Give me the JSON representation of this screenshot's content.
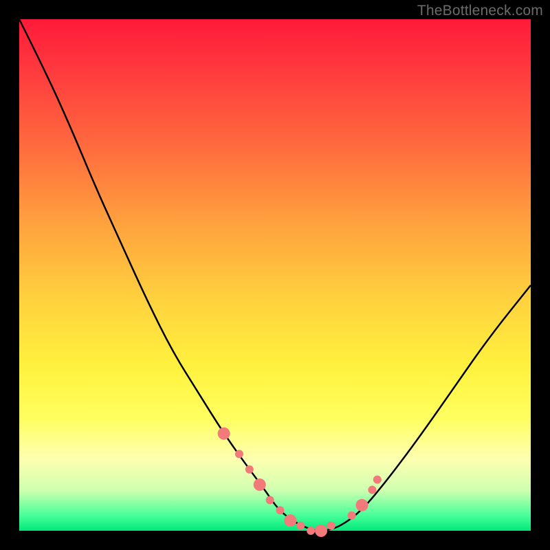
{
  "watermark": "TheBottleneck.com",
  "colors": {
    "gradient_top": "#ff1a3a",
    "gradient_bottom": "#00e97a",
    "curve": "#000000",
    "marker": "#f27a7a",
    "frame_bg": "#000000"
  },
  "chart_data": {
    "type": "line",
    "title": "",
    "xlabel": "",
    "ylabel": "",
    "xlim": [
      0,
      100
    ],
    "ylim": [
      0,
      100
    ],
    "grid": false,
    "legend": false,
    "series": [
      {
        "name": "bottleneck-curve",
        "x": [
          0,
          5,
          10,
          15,
          20,
          25,
          30,
          35,
          40,
          45,
          48,
          50,
          52,
          55,
          58,
          60,
          63,
          67,
          72,
          78,
          85,
          92,
          100
        ],
        "y": [
          100,
          90,
          79,
          67,
          56,
          45,
          35,
          27,
          19,
          12,
          8,
          5,
          3,
          1,
          0,
          0,
          1,
          4,
          10,
          18,
          28,
          38,
          48
        ]
      }
    ],
    "markers": {
      "name": "highlighted-points",
      "x": [
        40,
        43,
        45,
        47,
        49,
        51,
        53,
        55,
        57,
        59,
        61,
        65,
        67,
        69,
        70
      ],
      "y": [
        19,
        15,
        12,
        9,
        6,
        4,
        2,
        1,
        0,
        0,
        1,
        3,
        5,
        8,
        10
      ]
    }
  }
}
